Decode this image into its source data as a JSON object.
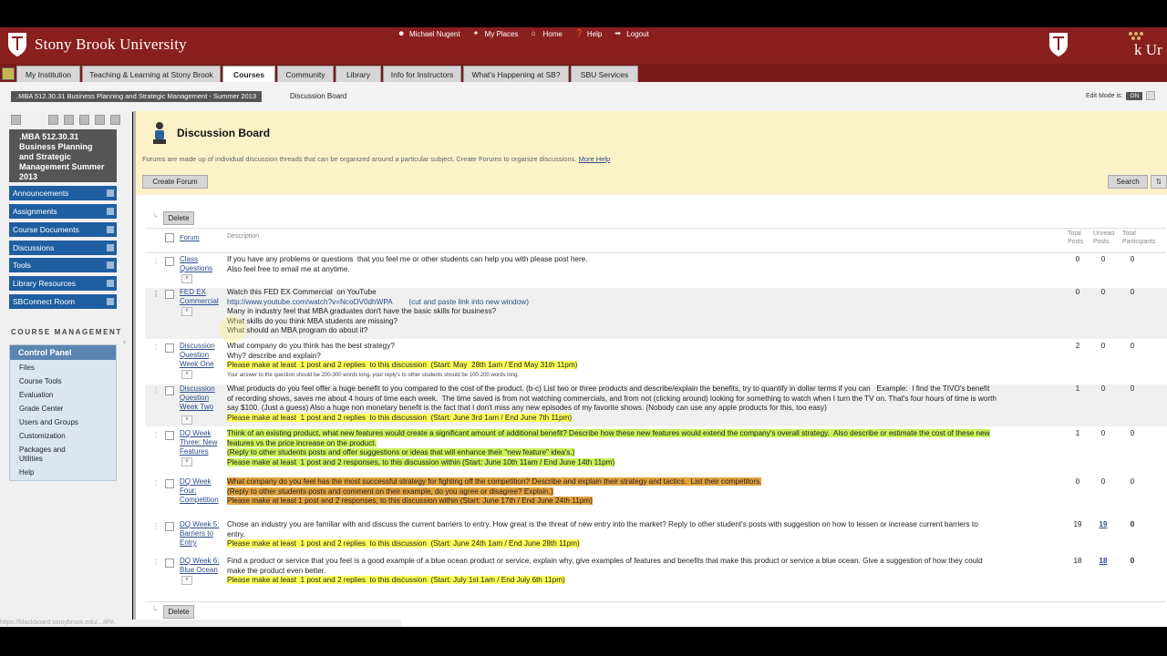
{
  "banner": {
    "university": "Stony Brook University",
    "right_logo_text": "k Ur",
    "links": [
      {
        "label": "Michael Nugent",
        "icon": "user-icon"
      },
      {
        "label": "My Places",
        "icon": "places-icon"
      },
      {
        "label": "Home",
        "icon": "home-icon"
      },
      {
        "label": "Help",
        "icon": "help-icon"
      },
      {
        "label": "Logout",
        "icon": "logout-icon"
      }
    ]
  },
  "tabs": [
    "My Institution",
    "Teaching & Learning at Stony Brook",
    "Courses",
    "Community",
    "Library",
    "Info for Instructors",
    "What's Happening at SB?",
    "SBU Services"
  ],
  "active_tab": "Courses",
  "breadcrumb": {
    "course": ".MBA 512.30.31 Business Planning and Strategic Management - Summer 2013",
    "page": "Discussion Board"
  },
  "edit_mode": {
    "label": "Edit Mode is:",
    "value": "ON"
  },
  "sidebar": {
    "course_title": ".MBA 512.30.31 Business Planning and Strategic Management Summer 2013",
    "items": [
      "Announcements",
      "Assignments",
      "Course Documents",
      "Discussions",
      "Tools",
      "Library Resources",
      "SBConnect Room"
    ],
    "management_heading": "COURSE MANAGEMENT",
    "control_panel": {
      "title": "Control Panel",
      "items": [
        "Files",
        "Course Tools",
        "Evaluation",
        "Grade Center",
        "Users and Groups",
        "Customization",
        "Packages and Utilities",
        "Help"
      ]
    }
  },
  "main": {
    "title": "Discussion Board",
    "intro": "Forums are made up of individual discussion threads that can be organized around a particular subject. Create Forums to organize discussions.",
    "more_help": "More Help",
    "create_forum": "Create Forum",
    "search": "Search",
    "delete": "Delete",
    "columns": {
      "forum": "Forum",
      "description": "Description",
      "total_posts": "Total Posts",
      "unread_posts": "Unread Posts",
      "total_participants": "Total Participants"
    },
    "forums": [
      {
        "name": "Class Questions",
        "lines": [
          "If you have any problems or questions  that you feel me or other students can help you with please post here.",
          "Also feel free to email me at anytime."
        ],
        "total": "0",
        "unread": "0",
        "participants": "0"
      },
      {
        "name": "FED EX Commercial",
        "lines": [
          "Watch this FED EX Commercial  on YouTube",
          "http://www.youtube.com/watch?v=NcoDV0dhWPA        (cut and paste link into new window)",
          "Many in industry feel that MBA graduates don't have the basic skills for business?",
          "What skills do you think MBA students are missing?",
          "What should an MBA program do about it?"
        ],
        "total": "0",
        "unread": "0",
        "participants": "0"
      },
      {
        "name": "Discussion Question Week One",
        "lines": [
          "What company do you think has the best strategy?",
          "Why? describe and explain?",
          "Please make at least  1 post and 2 replies  to this discussion  (Start: May  28th 1am / End May 31th 11pm)"
        ],
        "small": "Your answer to the question should be 200-300 words long, your reply's to other students should be 100-200 words long.",
        "total": "2",
        "unread": "0",
        "participants": "0"
      },
      {
        "name": "Discussion Question Week Two",
        "lines": [
          "What products do you feel offer a huge benefit to you compared to the cost of the product. (b-c) List two or three products and describe/explain the benefits, try to quantify in dollar terms if you can   Example:  I find the TIVO's benefit",
          "of recording shows, saves me about 4 hours of time each week.  The time saved is from not watching commercials, and from not (clicking around) looking for something to watch when I turn the TV on. That's four hours of time is worth",
          "say $100. (Just a guess) Also a huge non monetary benefit is the fact that I don't miss any new episodes of my favorite shows. (Nobody can use any apple products for this, too easy)",
          "Please make at least  1 post and 2 replies  to this discussion  (Start: June 3rd 1am / End June 7th 11pm)"
        ],
        "total": "1",
        "unread": "0",
        "participants": "0"
      },
      {
        "name": "DQ Week Three: New Features",
        "lines": [
          "Think of an existing product, what new features would create a significant amount of additional benefit? Describe how these new features would extend the company's overall strategy.  Also describe or estimate the cost of these new",
          "features vs the price increase on the product.",
          "(Reply to other students posts and offer suggestions or ideas that will enhance their \"new feature\" idea's.)",
          "Please make at least  1 post and 2 responses, to this discussion within (Start: June 10th 11am / End June 14th 11pm)"
        ],
        "total": "1",
        "unread": "0",
        "participants": "0"
      },
      {
        "name": "DQ Week Four: Competition",
        "lines": [
          "What company do you feel has the most successful strategy for fighting off the competition? Describe and explain their strategy and tactics.  List their competitors.",
          "(Reply to other students posts and comment on their example, do you agree or disagree? Explain.)",
          "Please make at least 1 post and 2 responses, to this discussion within (Start: June 17th / End June 24th 11pm)"
        ],
        "total": "0",
        "unread": "0",
        "participants": "0"
      },
      {
        "name": "DQ Week 5: Barriers to Entry",
        "lines": [
          "Chose an industry you are familiar with and discuss the current barriers to entry. How great is the threat of new entry into the market? Reply to other student's posts with suggestion on how to lessen or increase current barriers to",
          "entry.",
          "Please make at least  1 post and 2 replies  to this discussion  (Start: June 24th 1am / End June 28th 11pm)"
        ],
        "total": "19",
        "unread": "19",
        "participants": "0"
      },
      {
        "name": "DQ Week 6: Blue Ocean",
        "lines": [
          "Find a product or service that you feel is a good example of a blue ocean product or service, explain why, give examples of features and benefits that make this product or service a blue ocean. Give a suggestion of how they could",
          "make the product even better.",
          "",
          "Please make at least  1 post and 2 replies  to this discussion  (Start: July 1st 1am / End July 6th 11pm)"
        ],
        "total": "18",
        "unread": "18",
        "participants": "0"
      }
    ]
  },
  "status_url": "https://blackboard.stonybrook.edu/...#PA"
}
